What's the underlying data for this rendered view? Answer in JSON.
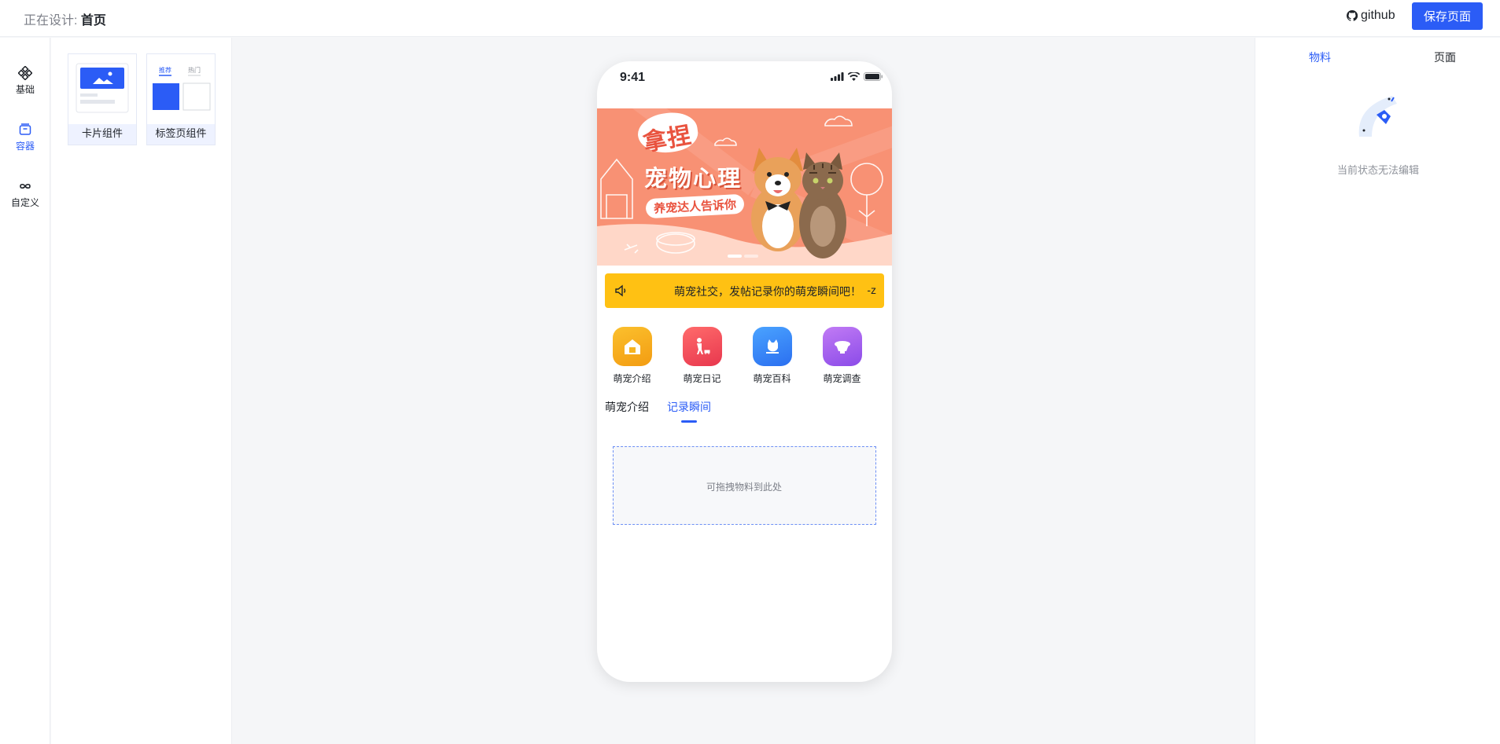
{
  "header": {
    "designing_label": "正在设计:",
    "page_name": "首页",
    "github_label": "github",
    "save_label": "保存页面"
  },
  "rail": {
    "items": [
      {
        "label": "基础",
        "icon": "grid-diamond-icon",
        "active": false
      },
      {
        "label": "容器",
        "icon": "container-box-icon",
        "active": true
      },
      {
        "label": "自定义",
        "icon": "infinity-icon",
        "active": false
      }
    ]
  },
  "materials": {
    "cards": [
      {
        "label": "卡片组件",
        "icon": "card-component-icon"
      },
      {
        "label": "标签页组件",
        "icon": "tabs-component-icon",
        "tab_labels": [
          "推荐",
          "热门"
        ]
      }
    ]
  },
  "phone": {
    "status_time": "9:41",
    "banner": {
      "bubble_text": "拿捏",
      "title": "宠物心理",
      "subtitle": "养宠达人告诉你"
    },
    "notice": {
      "icon": "speaker-icon",
      "text": "萌宠社交，发帖记录你的萌宠瞬间吧！",
      "trailing": "-z"
    },
    "grid": [
      {
        "label": "萌宠介绍",
        "icon": "pet-house-icon",
        "color": "#f9a825"
      },
      {
        "label": "萌宠日记",
        "icon": "walking-dog-icon",
        "color": "#f0465a"
      },
      {
        "label": "萌宠百科",
        "icon": "cat-icon",
        "color": "#3f8ef7"
      },
      {
        "label": "萌宠调查",
        "icon": "pet-bowl-icon",
        "color": "#a25bf2"
      }
    ],
    "tabs": [
      {
        "label": "萌宠介绍",
        "active": false
      },
      {
        "label": "记录瞬间",
        "active": true
      }
    ],
    "drop_zone_text": "可拖拽物料到此处"
  },
  "right_panel": {
    "tabs": [
      {
        "label": "物料",
        "active": true
      },
      {
        "label": "页面",
        "active": false
      }
    ],
    "empty_text": "当前状态无法编辑"
  },
  "colors": {
    "accent": "#2b5cf6",
    "notice_bg": "#ffc113",
    "banner_bg": "#f89174"
  }
}
